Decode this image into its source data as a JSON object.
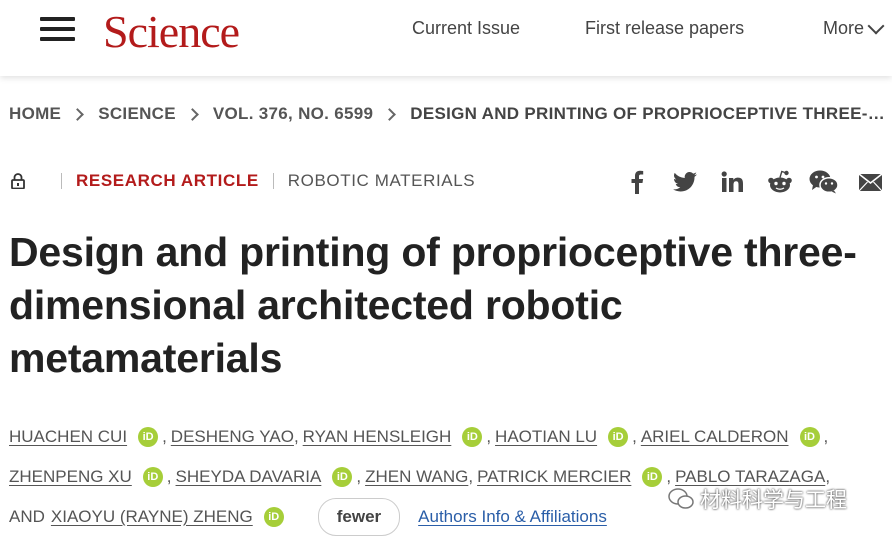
{
  "header": {
    "logo": "Science",
    "nav": [
      "Current Issue",
      "First release papers",
      "More"
    ]
  },
  "breadcrumb": [
    "HOME",
    "SCIENCE",
    "VOL. 376, NO. 6599",
    "DESIGN AND PRINTING OF PROPRIOCEPTIVE THREE-…"
  ],
  "article": {
    "type": "RESEARCH ARTICLE",
    "subject": "ROBOTIC MATERIALS",
    "title": "Design and printing of proprioceptive three-dimensional architected robotic metamaterials",
    "authors": [
      "HUACHEN CUI",
      "DESHENG YAO",
      "RYAN HENSLEIGH",
      "HAOTIAN LU",
      "ARIEL CALDERON",
      "ZHENPENG XU",
      "SHEYDA DAVARIA",
      "ZHEN WANG",
      "PATRICK MERCIER",
      "PABLO TARAZAGA",
      "XIAOYU (RAYNE) ZHENG"
    ],
    "and_word": "AND",
    "orcid_label": "iD",
    "fewer_label": "fewer",
    "affiliations_label": "Authors Info & Affiliations"
  },
  "share_icons": [
    "facebook-icon",
    "twitter-icon",
    "linkedin-icon",
    "reddit-icon",
    "wechat-icon",
    "email-icon"
  ],
  "watermark": "材料科学与工程",
  "colors": {
    "brand": "#b31b1b",
    "orcid": "#a6ce39",
    "link": "#2a5ea8"
  }
}
